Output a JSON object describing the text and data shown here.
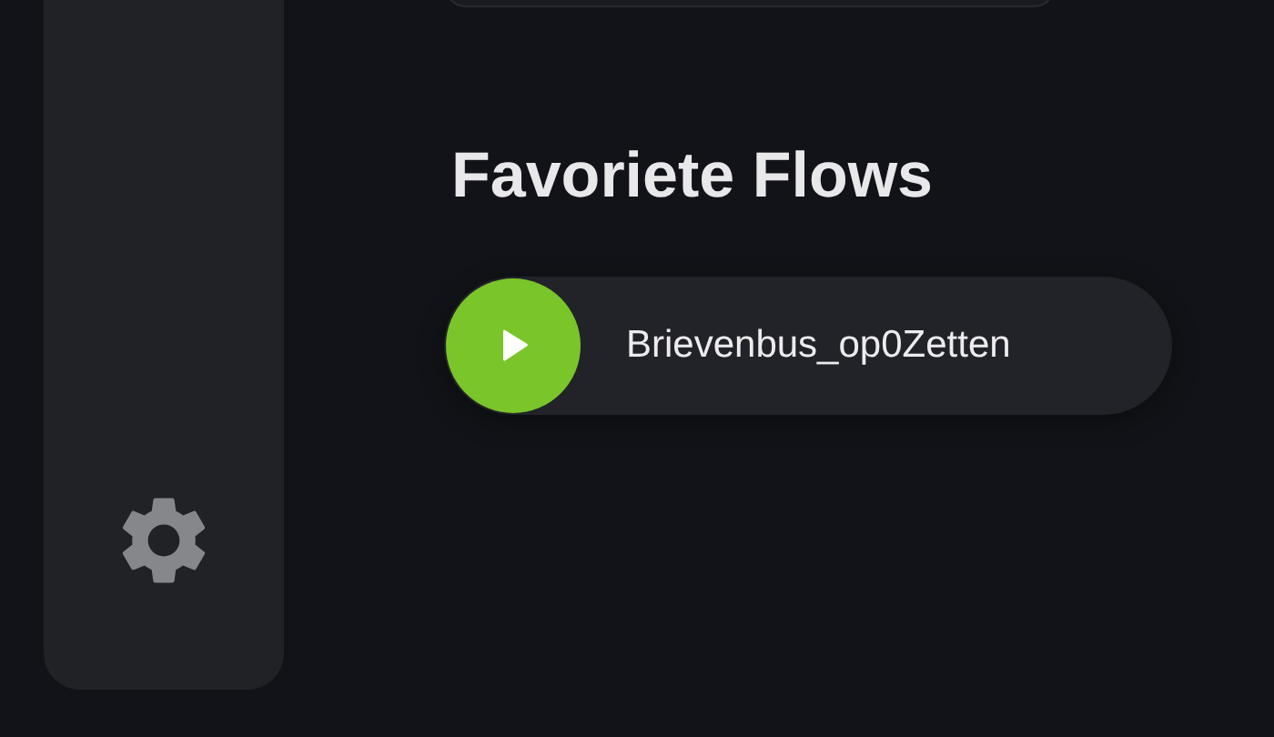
{
  "favorites": {
    "title": "Favoriete Flows",
    "flows": [
      {
        "name": "Brievenbus_op0Zetten"
      }
    ]
  }
}
